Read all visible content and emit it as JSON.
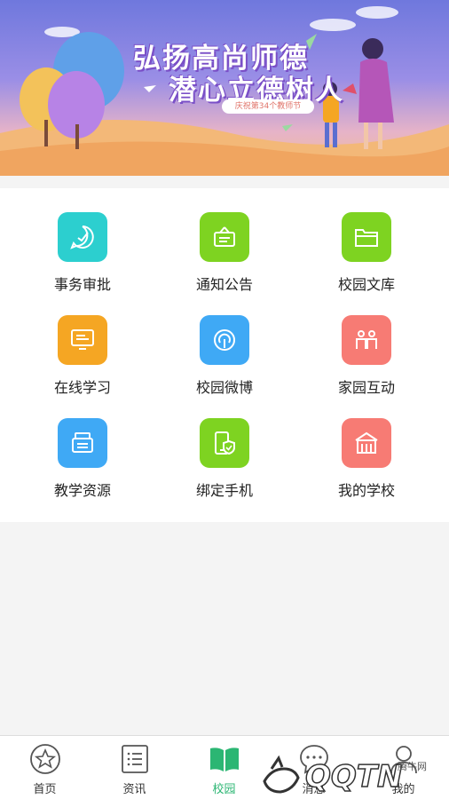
{
  "banner": {
    "line1": "弘扬高尚师德",
    "line2": "潜心立德树人",
    "subtitle": "庆祝第34个教师节"
  },
  "grid": [
    {
      "label": "事务审批",
      "icon": "chat-check-icon",
      "color": "#2ccfcf"
    },
    {
      "label": "通知公告",
      "icon": "notice-board-icon",
      "color": "#7ed321"
    },
    {
      "label": "校园文库",
      "icon": "folder-icon",
      "color": "#7ed321"
    },
    {
      "label": "在线学习",
      "icon": "monitor-icon",
      "color": "#f5a623"
    },
    {
      "label": "校园微博",
      "icon": "broadcast-icon",
      "color": "#3fa9f5"
    },
    {
      "label": "家园互动",
      "icon": "family-icon",
      "color": "#f77b74"
    },
    {
      "label": "教学资源",
      "icon": "inbox-icon",
      "color": "#3fa9f5"
    },
    {
      "label": "绑定手机",
      "icon": "phone-shield-icon",
      "color": "#7ed321"
    },
    {
      "label": "我的学校",
      "icon": "school-building-icon",
      "color": "#f77b74"
    }
  ],
  "tabs": [
    {
      "label": "首页",
      "icon": "star-icon"
    },
    {
      "label": "资讯",
      "icon": "list-icon"
    },
    {
      "label": "校园",
      "icon": "book-icon",
      "active": true
    },
    {
      "label": "消息",
      "icon": "chat-icon"
    },
    {
      "label": "我的",
      "icon": "person-icon"
    }
  ],
  "colors": {
    "accent": "#2bb673",
    "tab_inactive": "#333333"
  },
  "watermark": {
    "text": "QQTN",
    "site": "腾牛网"
  }
}
